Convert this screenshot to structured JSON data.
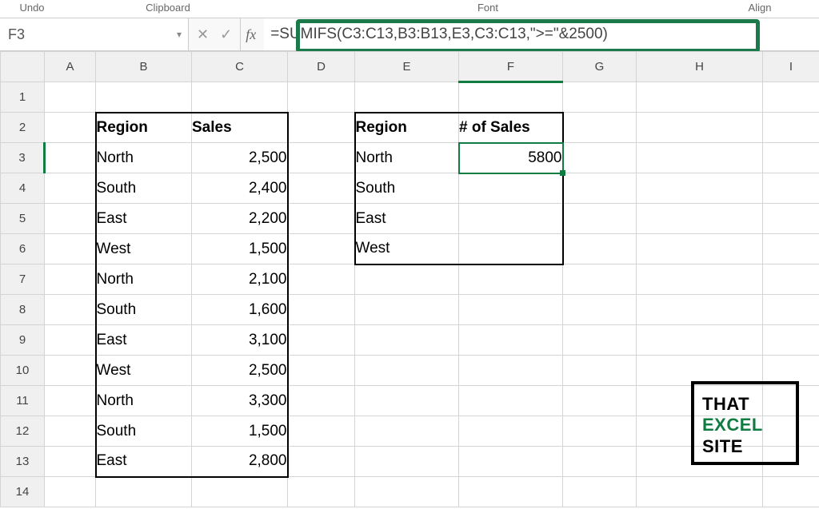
{
  "ribbon": {
    "undo": "Undo",
    "clipboard": "Clipboard",
    "font": "Font",
    "align": "Align"
  },
  "namebox": {
    "value": "F3"
  },
  "formula_bar": {
    "fx": "fx",
    "cancel_icon": "✕",
    "confirm_icon": "✓",
    "formula": "=SUMIFS(C3:C13,B3:B13,E3,C3:C13,\">=\"&2500)"
  },
  "columns": [
    "",
    "A",
    "B",
    "C",
    "D",
    "E",
    "F",
    "G",
    "H",
    "I"
  ],
  "row_headers": [
    "1",
    "2",
    "3",
    "4",
    "5",
    "6",
    "7",
    "8",
    "9",
    "10",
    "11",
    "12",
    "13",
    "14"
  ],
  "table1": {
    "header": {
      "region": "Region",
      "sales": "Sales"
    },
    "rows": [
      {
        "region": "North",
        "sales": "2,500"
      },
      {
        "region": "South",
        "sales": "2,400"
      },
      {
        "region": "East",
        "sales": "2,200"
      },
      {
        "region": "West",
        "sales": "1,500"
      },
      {
        "region": "North",
        "sales": "2,100"
      },
      {
        "region": "South",
        "sales": "1,600"
      },
      {
        "region": "East",
        "sales": "3,100"
      },
      {
        "region": "West",
        "sales": "2,500"
      },
      {
        "region": "North",
        "sales": "3,300"
      },
      {
        "region": "South",
        "sales": "1,500"
      },
      {
        "region": "East",
        "sales": "2,800"
      }
    ]
  },
  "table2": {
    "header": {
      "region": "Region",
      "count": "# of Sales"
    },
    "rows": [
      {
        "region": "North",
        "count": "5800"
      },
      {
        "region": "South",
        "count": ""
      },
      {
        "region": "East",
        "count": ""
      },
      {
        "region": "West",
        "count": ""
      }
    ]
  },
  "watermark": {
    "l1": "THAT",
    "l2": "EXCEL",
    "l3": "SITE"
  },
  "chart_data": {
    "type": "table",
    "title": "SUMIFS example: sum Sales by Region where Sales >= 2500",
    "source": {
      "columns": [
        "Region",
        "Sales"
      ],
      "rows": [
        [
          "North",
          2500
        ],
        [
          "South",
          2400
        ],
        [
          "East",
          2200
        ],
        [
          "West",
          1500
        ],
        [
          "North",
          2100
        ],
        [
          "South",
          1600
        ],
        [
          "East",
          3100
        ],
        [
          "West",
          2500
        ],
        [
          "North",
          3300
        ],
        [
          "South",
          1500
        ],
        [
          "East",
          2800
        ]
      ]
    },
    "result": {
      "columns": [
        "Region",
        "# of Sales"
      ],
      "rows": [
        [
          "North",
          5800
        ],
        [
          "South",
          null
        ],
        [
          "East",
          null
        ],
        [
          "West",
          null
        ]
      ]
    },
    "formula_cell": "F3",
    "formula": "=SUMIFS(C3:C13,B3:B13,E3,C3:C13,\">=\"&2500)"
  }
}
